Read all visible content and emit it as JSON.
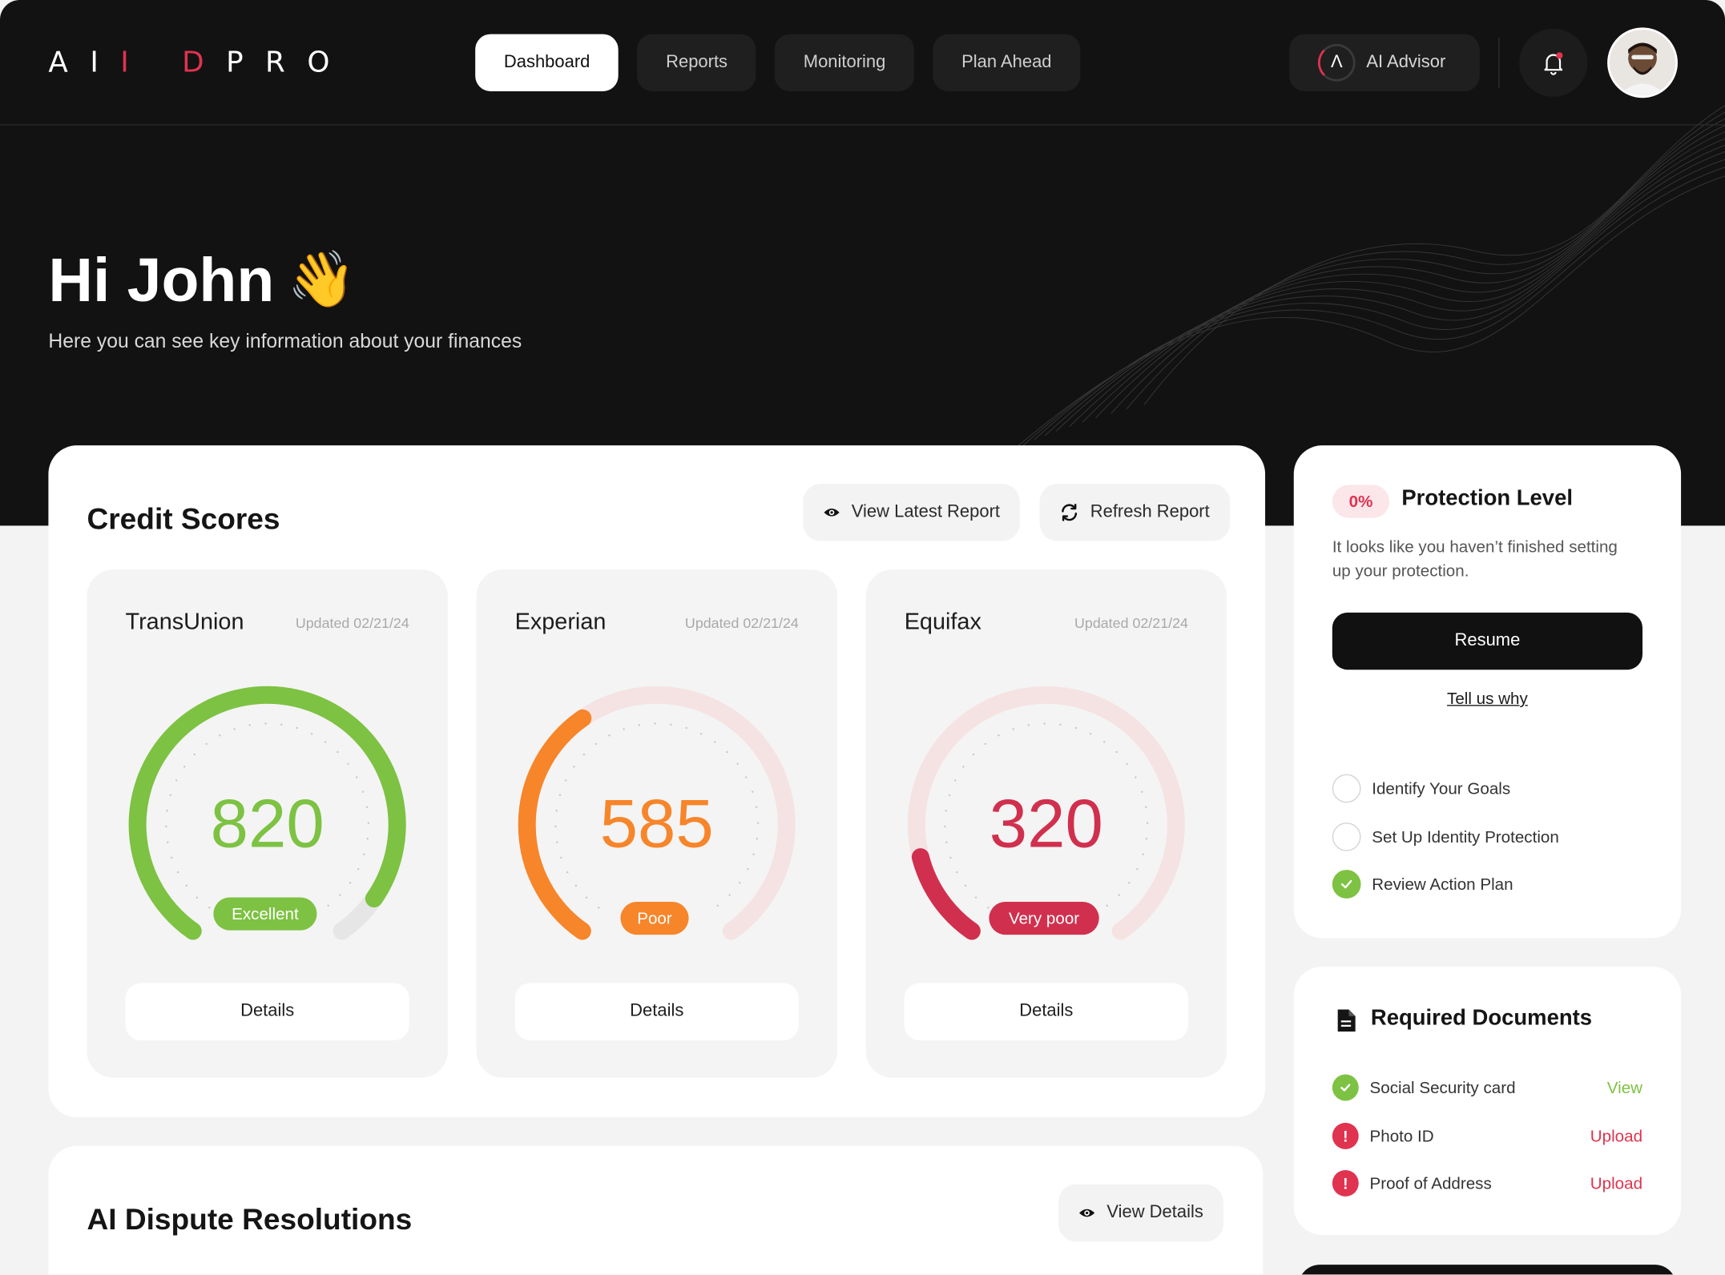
{
  "app": {
    "logo_text_a": "A",
    "logo_text_i": "I",
    "logo_text_red": "I D",
    "logo_text_rest": "PRO"
  },
  "nav": {
    "tabs": [
      {
        "label": "Dashboard",
        "active": true
      },
      {
        "label": "Reports",
        "active": false
      },
      {
        "label": "Monitoring",
        "active": false
      },
      {
        "label": "Plan Ahead",
        "active": false
      }
    ],
    "advisor_label": "AI Advisor"
  },
  "hero": {
    "greeting": "Hi John",
    "wave_icon": "👋",
    "subtitle": "Here you can see key information about your finances"
  },
  "credit": {
    "title": "Credit Scores",
    "view_latest_label": "View Latest Report",
    "refresh_label": "Refresh Report",
    "bureaus": [
      {
        "name": "TransUnion",
        "updated": "Updated 02/21/24",
        "score": "820",
        "rating": "Excellent",
        "fill": 1.0,
        "color": "#7dc242",
        "details": "Details"
      },
      {
        "name": "Experian",
        "updated": "Updated 02/21/24",
        "score": "585",
        "rating": "Poor",
        "fill": 0.38,
        "color": "#f7852a",
        "details": "Details"
      },
      {
        "name": "Equifax",
        "updated": "Updated 02/21/24",
        "score": "320",
        "rating": "Very poor",
        "fill": 0.14,
        "color": "#d0304e",
        "details": "Details"
      }
    ]
  },
  "ai_dispute": {
    "title": "AI Dispute Resolutions",
    "view_details_label": "View Details"
  },
  "protection": {
    "percent": "0%",
    "title": "Protection Level",
    "text": "It looks like you haven’t finished setting up your protection.",
    "resume_label": "Resume",
    "tell_us_label": "Tell us why",
    "steps": [
      {
        "label": "Identify Your Goals",
        "done": false
      },
      {
        "label": "Set Up Identity Protection",
        "done": false
      },
      {
        "label": "Review Action Plan",
        "done": true
      }
    ]
  },
  "documents": {
    "title": "Required Documents",
    "items": [
      {
        "label": "Social Security card",
        "status": "ok",
        "action": "View"
      },
      {
        "label": "Photo ID",
        "status": "missing",
        "action": "Upload"
      },
      {
        "label": "Proof of Address",
        "status": "missing",
        "action": "Upload"
      }
    ]
  },
  "colors": {
    "accent_red": "#e0334f",
    "green": "#7dc242",
    "orange": "#f7852a",
    "dark": "#121212"
  }
}
